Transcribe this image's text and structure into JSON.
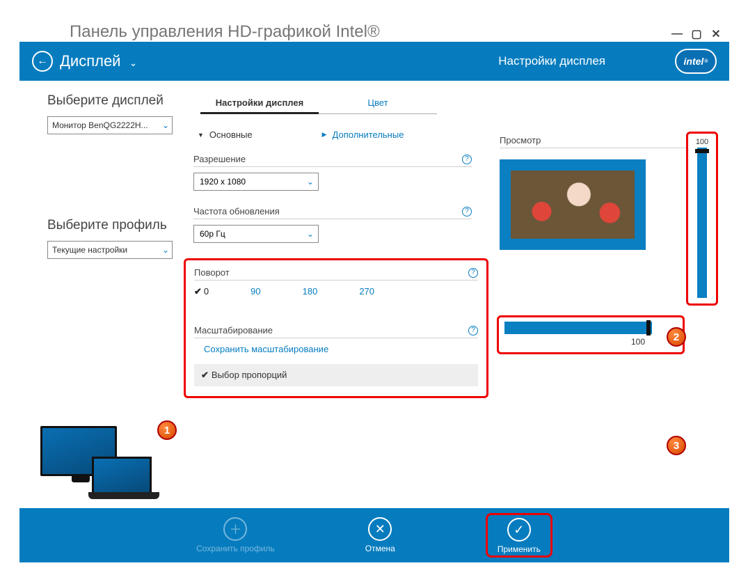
{
  "window": {
    "title": "Панель управления HD-графикой Intel®"
  },
  "header": {
    "section": "Дисплей",
    "subtitle": "Настройки дисплея",
    "logo_text": "intel"
  },
  "left": {
    "select_display_label": "Выберите дисплей",
    "display_value": "Монитор BenQG2222H...",
    "select_profile_label": "Выберите профиль",
    "profile_value": "Текущие настройки"
  },
  "tabs": {
    "display_settings": "Настройки дисплея",
    "color": "Цвет"
  },
  "subtabs": {
    "basic": "Основные",
    "advanced": "Дополнительные"
  },
  "fields": {
    "resolution_label": "Разрешение",
    "resolution_value": "1920 x 1080",
    "refresh_label": "Частота обновления",
    "refresh_value": "60p Гц",
    "rotation_label": "Поворот",
    "rotation_options": {
      "r0": "0",
      "r90": "90",
      "r180": "180",
      "r270": "270"
    },
    "scaling_label": "Масштабирование",
    "save_scaling": "Сохранить масштабирование",
    "aspect_choice": "Выбор пропорций"
  },
  "preview": {
    "label": "Просмотр",
    "v_value": "100",
    "h_value": "100"
  },
  "footer": {
    "save_profile": "Сохранить профиль",
    "cancel": "Отмена",
    "apply": "Применить"
  },
  "callouts": {
    "one": "1",
    "two": "2",
    "three": "3"
  }
}
